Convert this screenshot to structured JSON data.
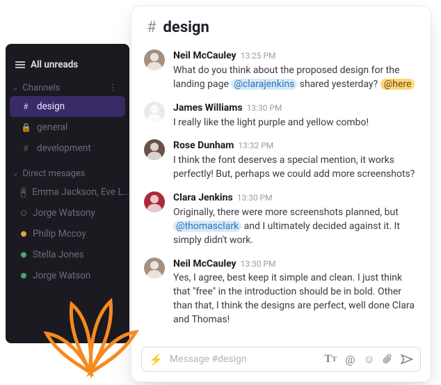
{
  "sidebar": {
    "allUnreadsLabel": "All unreads",
    "channelsLabel": "Channels",
    "channels": [
      {
        "label": "design",
        "icon": "#",
        "active": true
      },
      {
        "label": "general",
        "icon": "lock",
        "active": false
      },
      {
        "label": "development",
        "icon": "#",
        "active": false
      }
    ],
    "dmLabel": "Direct mesages",
    "dms": [
      {
        "label": "Emma Jackson, Eve L…",
        "icon": "4"
      },
      {
        "label": "Jorge Watsony",
        "presence": "off"
      },
      {
        "label": "Philip Mccoy",
        "presence": "idle"
      },
      {
        "label": "Stella Jones",
        "presence": "on"
      },
      {
        "label": "Jorge Watson",
        "presence": "on"
      }
    ]
  },
  "chat": {
    "channelName": "design",
    "composerPlaceholder": "Message #design",
    "messages": [
      {
        "sender": "Neil McCauley",
        "time": "13:25 PM",
        "avatarColor": "#a58f7e",
        "segments": [
          {
            "t": "text",
            "v": "What do you think about the proposed design for the landing page "
          },
          {
            "t": "mention",
            "v": "@clarajenkins"
          },
          {
            "t": "text",
            "v": " shared yesterday? "
          },
          {
            "t": "here",
            "v": "@here"
          }
        ]
      },
      {
        "sender": "James Williams",
        "time": "13:30 PM",
        "avatarColor": "#e9e9ef",
        "segments": [
          {
            "t": "text",
            "v": "I really like the light purple and yellow combo!"
          }
        ]
      },
      {
        "sender": "Rose Dunham",
        "time": "13:32 PM",
        "avatarColor": "#6b5148",
        "segments": [
          {
            "t": "text",
            "v": "I think the font deserves a special mention, it works perfectly! But, perhaps we could add more screenshots?"
          }
        ]
      },
      {
        "sender": "Clara Jenkins",
        "time": "13:30 PM",
        "avatarColor": "#ab2a3a",
        "segments": [
          {
            "t": "text",
            "v": "Originally, there were more screenshots planned, but "
          },
          {
            "t": "mention",
            "v": "@thomasclark"
          },
          {
            "t": "text",
            "v": " and I ultimately decided against it. It simply didn't work."
          }
        ]
      },
      {
        "sender": "Neil McCauley",
        "time": "13:30 PM",
        "avatarColor": "#a58f7e",
        "segments": [
          {
            "t": "text",
            "v": "Yes, I agree, best keep it simple and clean. I just think that \"free\" in the introduction should be in bold. Other than that, I think the designs are perfect, well done Clara and Thomas!"
          }
        ]
      }
    ]
  }
}
